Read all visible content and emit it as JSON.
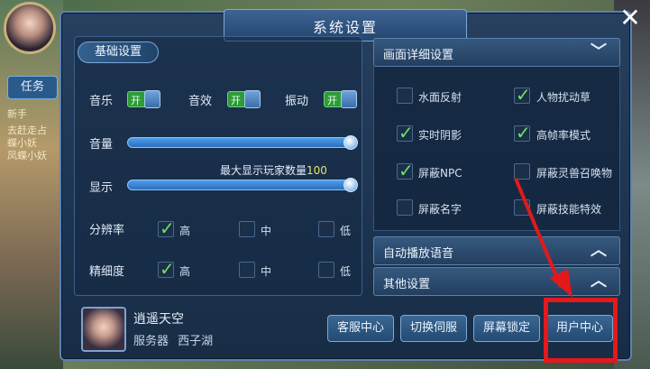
{
  "background": {
    "task_tab": "任务",
    "task_lines": [
      "新手",
      "去赶走占",
      "蝶小妖",
      "凤蝶小妖"
    ]
  },
  "dialog": {
    "title": "系统设置",
    "close_glyph": "✕"
  },
  "basic": {
    "header": "基础设置",
    "music_label": "音乐",
    "sfx_label": "音效",
    "vibrate_label": "振动",
    "toggle_on_text": "开",
    "volume_label": "音量",
    "display_label": "显示",
    "max_players_text": "最大显示玩家数量",
    "max_players_value": "100",
    "volume_level": 1.0,
    "display_level": 1.0,
    "resolution_label": "分辨率",
    "detail_label": "精细度",
    "options": [
      "高",
      "中",
      "低"
    ],
    "resolution_selected": "高",
    "detail_selected": "高"
  },
  "graphics": {
    "header": "画面详细设置",
    "items": [
      {
        "label": "水面反射",
        "checked": false
      },
      {
        "label": "人物扰动草",
        "checked": true
      },
      {
        "label": "实时阴影",
        "checked": true
      },
      {
        "label": "高帧率模式",
        "checked": true
      },
      {
        "label": "屏蔽NPC",
        "checked": true
      },
      {
        "label": "屏蔽灵兽召唤物",
        "checked": false
      },
      {
        "label": "屏蔽名字",
        "checked": false
      },
      {
        "label": "屏蔽技能特效",
        "checked": false
      }
    ]
  },
  "auto_voice": {
    "header": "自动播放语音"
  },
  "other": {
    "header": "其他设置"
  },
  "player": {
    "name": "逍遥天空",
    "server_label": "服务器",
    "server_name": "西子湖"
  },
  "buttons": {
    "customer_service": "客服中心",
    "switch_server": "切换伺服",
    "lock_screen": "屏幕锁定",
    "user_center": "用户中心"
  },
  "colors": {
    "accent_blue": "#4f9de8",
    "toggle_green": "#2e9a3a",
    "check_green": "#6fe06a",
    "highlight_red": "#e3191b"
  }
}
